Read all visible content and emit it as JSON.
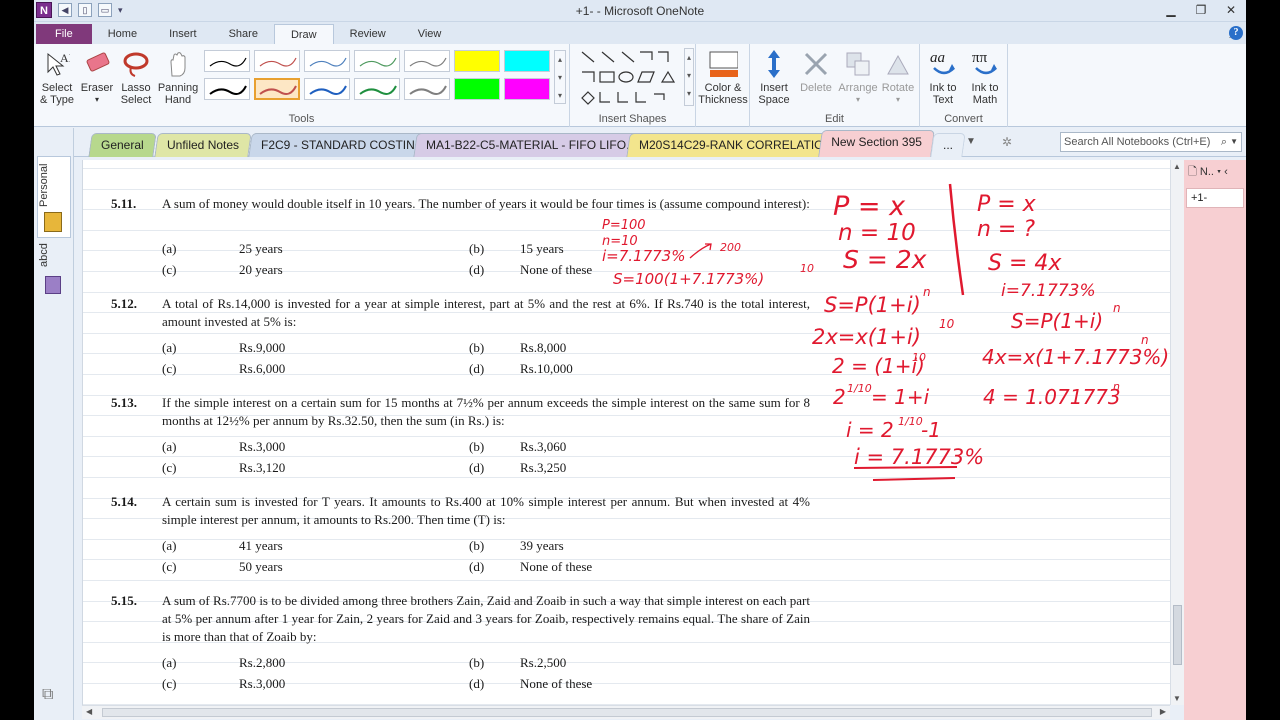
{
  "window": {
    "title": "+1-  -  Microsoft OneNote"
  },
  "qat": {
    "logo": "N"
  },
  "tabs": [
    "File",
    "Home",
    "Insert",
    "Share",
    "Draw",
    "Review",
    "View"
  ],
  "ribbon": {
    "tools": {
      "label": "Tools",
      "select": "Select\n& Type",
      "eraser": "Eraser",
      "lasso": "Lasso\nSelect",
      "panning": "Panning\nHand"
    },
    "insert_shapes": {
      "label": "Insert Shapes"
    },
    "color": {
      "label": "Color &\nThickness"
    },
    "edit": {
      "label": "Edit",
      "insert_space": "Insert\nSpace",
      "delete": "Delete",
      "arrange": "Arrange",
      "rotate": "Rotate"
    },
    "convert": {
      "label": "Convert",
      "ink_to_text": "Ink to\nText",
      "ink_to_math": "Ink to\nMath"
    },
    "pen_colors": [
      "#000000",
      "#c0504d",
      "#4f81bd",
      "#4f9a5f",
      "#7f7f7f",
      "#ffff00",
      "#00ffff",
      "#000000",
      "#c0504d",
      "#1f5fbf",
      "#1f8f3f",
      "#7f7f7f",
      "#00ff00",
      "#ff00ff"
    ]
  },
  "sections": [
    "General",
    "Unfiled Notes",
    "F2C9 - STANDARD COSTING",
    "MA1-B22-C5-MATERIAL - FIFO LIFO...",
    "M20S14C29-RANK CORRELATION",
    "New Section 395",
    "..."
  ],
  "search": {
    "placeholder": "Search All Notebooks (Ctrl+E)"
  },
  "notebooks": {
    "personal": "Personal",
    "abcd": "abcd"
  },
  "pages_panel": {
    "header": "N..",
    "page": "+1-"
  },
  "questions": [
    {
      "num": "5.11.",
      "text": "A sum of money would double itself in 10 years. The number of years it would be four times is (assume compound interest):",
      "a": "25 years",
      "b": "15 years",
      "c": "20 years",
      "d": "None of these"
    },
    {
      "num": "5.12.",
      "text": "A total of Rs.14,000 is invested for a year at simple interest, part at 5% and the rest at 6%. If Rs.740 is the total interest, amount invested at 5% is:",
      "a": "Rs.9,000",
      "b": "Rs.8,000",
      "c": "Rs.6,000",
      "d": "Rs.10,000"
    },
    {
      "num": "5.13.",
      "text": "If the simple interest on a certain sum for 15 months at 7½% per annum exceeds the simple interest on the same sum for 8 months at 12½% per annum by Rs.32.50, then the sum (in Rs.) is:",
      "a": "Rs.3,000",
      "b": "Rs.3,060",
      "c": "Rs.3,120",
      "d": "Rs.3,250"
    },
    {
      "num": "5.14.",
      "text": "A certain sum is invested for T years. It amounts to Rs.400 at 10% simple interest per annum. But when invested at 4% simple interest per annum, it amounts to Rs.200. Then time (T) is:",
      "a": "41 years",
      "b": "39 years",
      "c": "50 years",
      "d": "None of these"
    },
    {
      "num": "5.15.",
      "text": "A sum of Rs.7700 is to be divided among three brothers Zain, Zaid and Zoaib in such a way that simple interest on each part at 5% per annum after 1 year for Zain, 2 years for Zaid and 3 years for Zoaib, respectively remains equal. The share of Zain is more than that of Zoaib by:",
      "a": "Rs.2,800",
      "b": "Rs.2,500",
      "c": "Rs.3,000",
      "d": "None of these"
    }
  ],
  "option_labels": {
    "a": "(a)",
    "b": "(b)",
    "c": "(c)",
    "d": "(d)"
  },
  "ink": {
    "small": [
      "P=100",
      "n=10",
      "i=7.1773%",
      "200",
      "S=100(1+7.1773%)",
      "10"
    ],
    "left": [
      "P = x",
      "n = 10",
      "S = 2x",
      "S=P(1+i)",
      "n",
      "2x=x(1+i)",
      "10",
      "2 = (1+i)",
      "10",
      "2",
      "1/10",
      "= 1+i",
      "i = 2",
      "1/10",
      "-1",
      "i = 7.1773%"
    ],
    "right": [
      "P = x",
      "n = ?",
      "S = 4x",
      "i=7.1773%",
      "S=P(1+i)",
      "n",
      "n",
      "4x=x(1+7.1773%)",
      "4 = 1.071773",
      "n"
    ]
  }
}
